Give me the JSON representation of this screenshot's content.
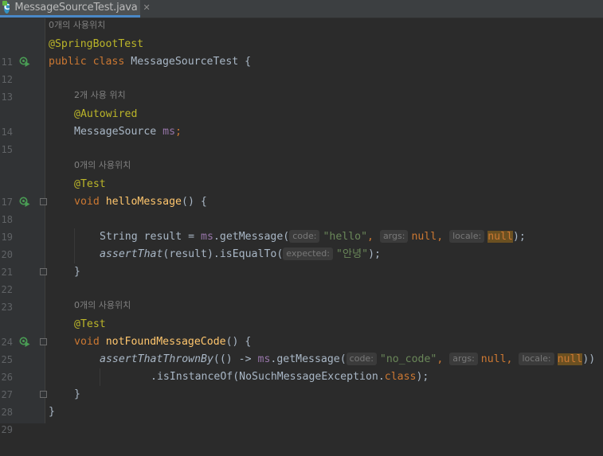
{
  "tab": {
    "icon_letter": "C",
    "title": "MessageSourceTest.java",
    "close": "✕"
  },
  "hints": {
    "usages_0": "0개의 사용위치",
    "usages_2": "2개 사용 위치"
  },
  "lines": {
    "l11": "11",
    "l12": "12",
    "l13": "13",
    "l14": "14",
    "l15": "15",
    "l17": "17",
    "l18": "18",
    "l19": "19",
    "l20": "20",
    "l21": "21",
    "l22": "22",
    "l23": "23",
    "l24": "24",
    "l25": "25",
    "l26": "26",
    "l27": "27",
    "l28": "28",
    "l29": "29"
  },
  "code": {
    "a_springboottest": "@SpringBootTest",
    "kw_public": "public",
    "kw_class": "class",
    "class_name": "MessageSourceTest {",
    "a_autowired": "@Autowired",
    "type_messagesource": "MessageSource ",
    "field_ms": "ms",
    "semi": ";",
    "a_test": "@Test",
    "kw_void": "void",
    "m_hello": "helloMessage",
    "parens_open": "() {",
    "string_result": "String result = ",
    "get_message_call": ".getMessage(",
    "inlay_code": "code:",
    "str_hello": "\"hello\"",
    "comma": ",",
    "inlay_args": "args:",
    "kw_null": "null",
    "inlay_locale": "locale:",
    "close_paren_semi": ");",
    "assert_that": "assertThat",
    "result_is_equal": "(result).isEqualTo(",
    "inlay_expected": "expected:",
    "str_annyeong": "\"안녕\"",
    "close_brace": "}",
    "m_notfound": "notFoundMessageCode",
    "assert_thrown_by": "assertThatThrownBy",
    "lambda_start": "(() -> ",
    "str_no_code": "\"no_code\"",
    "close_parens_double": "))",
    "is_instance_of": ".isInstanceOf(NoSuchMessageException.",
    "kw_class2": "class"
  },
  "colors": {
    "background": "#2b2b2b",
    "keyword": "#cc7832",
    "annotation": "#bbb529",
    "string": "#6a8759",
    "field": "#9876aa",
    "method_decl": "#ffc66d",
    "run_icon": "#499c54"
  },
  "icons": {
    "run": "run-test-icon",
    "fold": "fold-icon"
  }
}
